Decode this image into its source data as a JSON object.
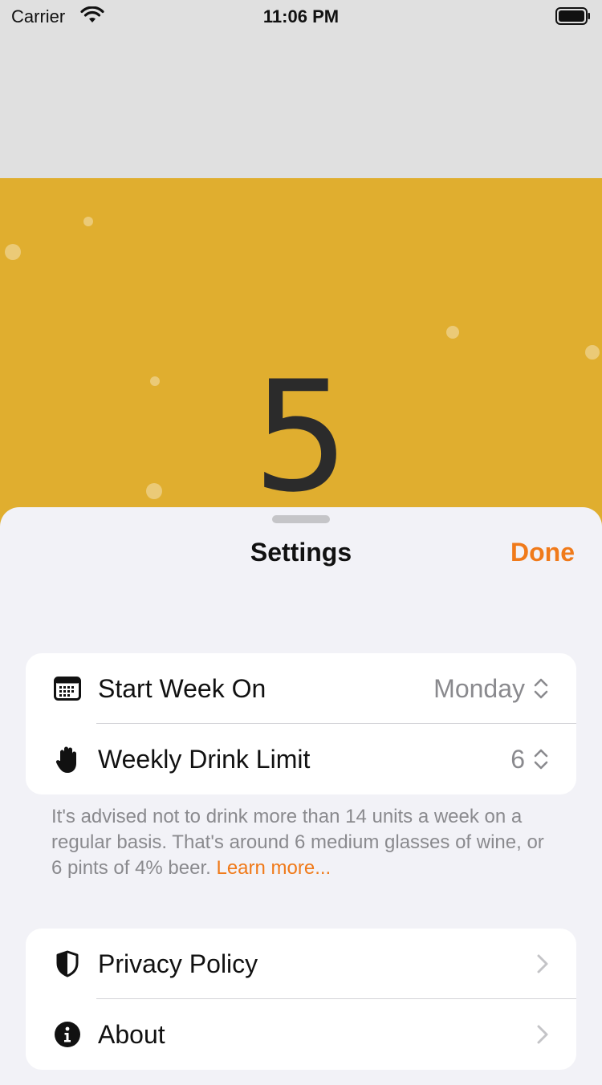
{
  "status_bar": {
    "carrier": "Carrier",
    "time": "11:06 PM"
  },
  "counter": {
    "value": "5"
  },
  "colors": {
    "beer": "#e0ae2f",
    "accent": "#f07a1a",
    "sheet_bg": "#f2f2f7"
  },
  "sheet": {
    "title": "Settings",
    "done_label": "Done",
    "week_group": {
      "start_week": {
        "icon": "calendar-icon",
        "label": "Start Week On",
        "value": "Monday"
      },
      "drink_limit": {
        "icon": "hand-raised-icon",
        "label": "Weekly Drink Limit",
        "value": "6"
      }
    },
    "footnote": {
      "text": "It's advised not to drink more than 14 units a week on a regular basis. That's around 6 medium glasses of wine, or 6 pints of 4% beer.",
      "link": "Learn more..."
    },
    "info_group": {
      "privacy": {
        "icon": "shield-icon",
        "label": "Privacy Policy"
      },
      "about": {
        "icon": "info-icon",
        "label": "About"
      }
    }
  }
}
